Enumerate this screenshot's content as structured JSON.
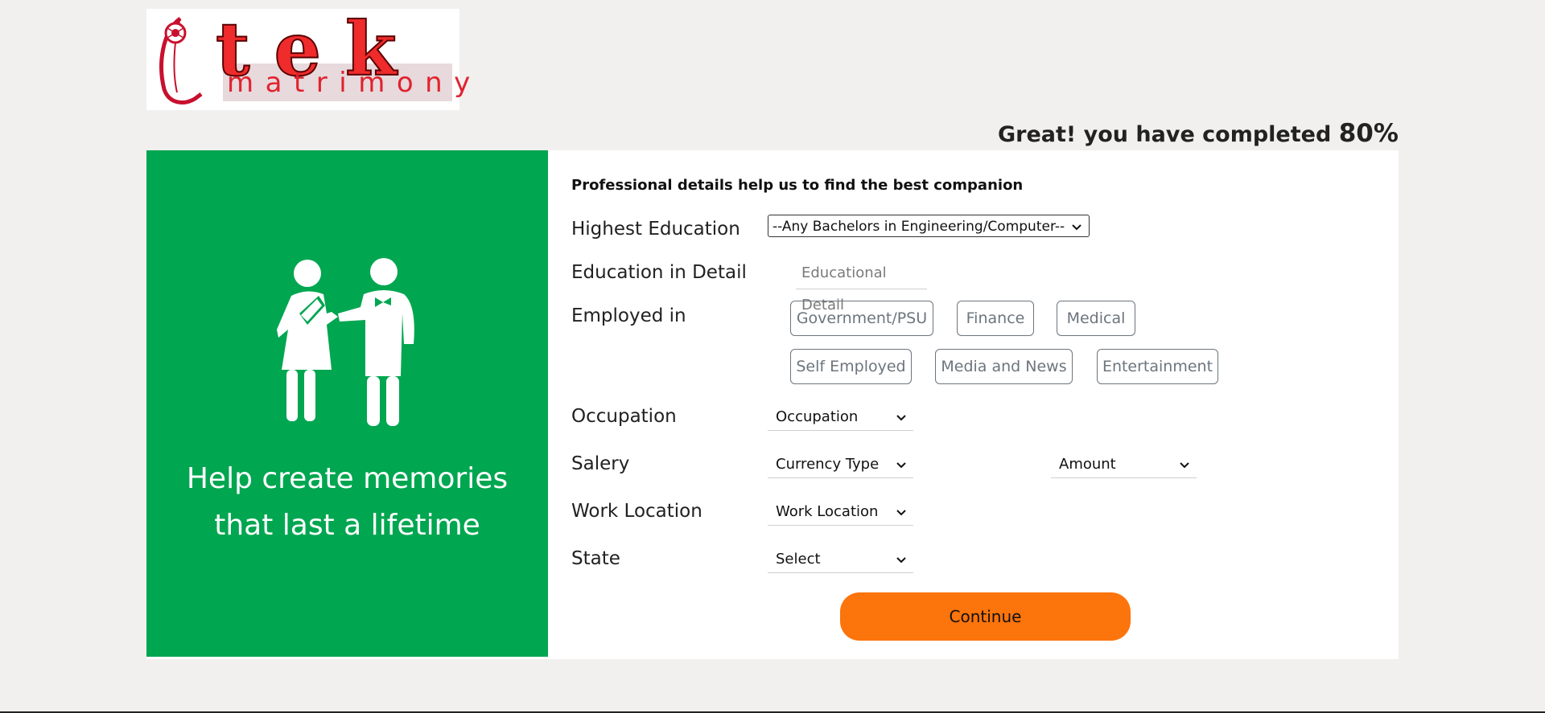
{
  "brand": {
    "logo_word": "tek",
    "logo_sub": "matrimony",
    "primary_red": "#ef2b2b"
  },
  "progress": {
    "message": "Great! you have completed ",
    "percent_label": "80%",
    "percent": 80
  },
  "hero": {
    "tagline_line1": "Help create memories",
    "tagline_line2": "that last a lifetime",
    "bg_color": "#00a650",
    "image_icon": "couple-icon"
  },
  "form": {
    "heading": "Professional details help us to find the best companion",
    "highest_education": {
      "label": "Highest Education",
      "selected": "--Any Bachelors in Engineering/Computer--"
    },
    "education_detail": {
      "label": "Education in Detail",
      "placeholder": "Educational Detail"
    },
    "employed_in": {
      "label": "Employed in",
      "options": [
        "Government/PSU",
        "Finance",
        "Medical",
        "Self Employed",
        "Media and News",
        "Entertainment"
      ]
    },
    "occupation": {
      "label": "Occupation",
      "selected": "Occupation"
    },
    "salary": {
      "label": "Salery",
      "currency_selected": "Currency Type",
      "amount_selected": "Amount"
    },
    "work_location": {
      "label": "Work Location",
      "selected": "Work Location"
    },
    "state": {
      "label": "State",
      "selected": "Select"
    },
    "continue_label": "Continue",
    "accent_color": "#fc740c"
  }
}
